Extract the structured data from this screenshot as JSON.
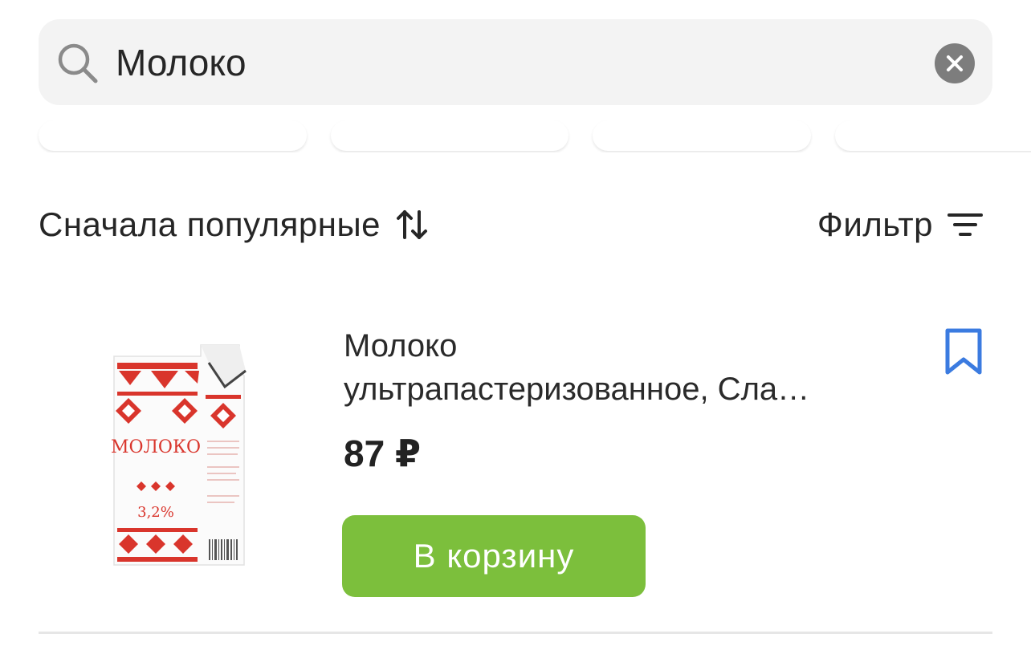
{
  "search": {
    "value": "Молоко",
    "icon": "search-icon",
    "clear_icon": "close-icon"
  },
  "toolbar": {
    "sort_label": "Сначала популярные",
    "sort_icon": "sort-arrows-icon",
    "filter_label": "Фильтр",
    "filter_icon": "filter-lines-icon"
  },
  "product": {
    "title_line1": "Молоко",
    "title_line2": "ультрапастеризованное, Сла…",
    "price": "87 ₽",
    "cart_button_label": "В корзину",
    "bookmark_icon": "bookmark-icon",
    "package_brand": "МОЛОКО",
    "package_fat": "3,2%"
  },
  "colors": {
    "accent_green": "#7cbf3c",
    "bookmark_blue": "#3b7be0",
    "search_bg": "#f3f3f3",
    "clear_gray": "#7d7d7d"
  }
}
